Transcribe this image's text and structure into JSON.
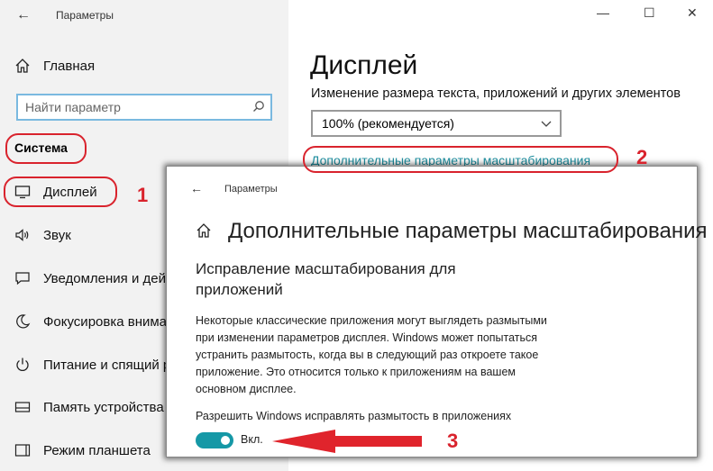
{
  "app": {
    "title": "Параметры"
  },
  "window_controls": {
    "minimize": "—",
    "maximize": "☐",
    "close": "✕"
  },
  "sidebar": {
    "home": "Главная",
    "search_placeholder": "Найти параметр",
    "section": "Система",
    "items": [
      {
        "label": "Дисплей",
        "icon": "monitor-icon"
      },
      {
        "label": "Звук",
        "icon": "speaker-icon"
      },
      {
        "label": "Уведомления и дей",
        "icon": "notification-icon"
      },
      {
        "label": "Фокусировка внима",
        "icon": "moon-icon"
      },
      {
        "label": "Питание и спящий р",
        "icon": "power-icon"
      },
      {
        "label": "Память устройства",
        "icon": "storage-icon"
      },
      {
        "label": "Режим планшета",
        "icon": "tablet-icon"
      }
    ]
  },
  "main": {
    "title": "Дисплей",
    "scale_label": "Изменение размера текста, приложений и других элементов",
    "scale_value": "100% (рекомендуется)",
    "advanced_link": "Дополнительные параметры масштабирования"
  },
  "overlay": {
    "app_title": "Параметры",
    "title": "Дополнительные параметры масштабирования",
    "subtitle": "Исправление масштабирования для приложений",
    "body": "Некоторые классические приложения могут выглядеть размытыми при изменении параметров дисплея. Windows может попытаться устранить размытость, когда вы в следующий раз откроете такое приложение. Это относится только к приложениям на вашем основном дисплее.",
    "toggle_label": "Разрешить Windows исправлять размытость в приложениях",
    "toggle_state": "Вкл."
  },
  "annotations": {
    "n1": "1",
    "n2": "2",
    "n3": "3",
    "color": "#d9232d"
  },
  "colors": {
    "accent": "#1598a6",
    "link": "#1e8fa0",
    "sidebar_bg": "#f2f2f2"
  }
}
